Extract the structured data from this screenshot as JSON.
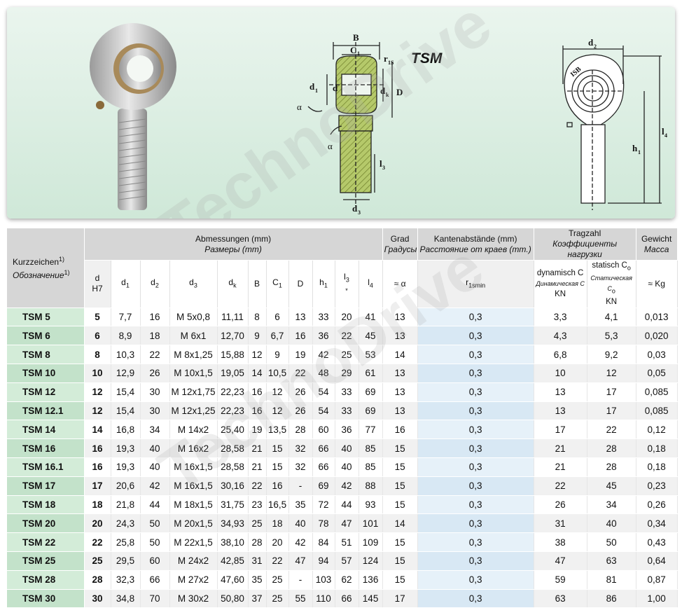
{
  "diagram": {
    "model": "TSM",
    "labels": {
      "B": "B",
      "C1": "C",
      "C1_sub": "1",
      "r1s": "r",
      "r1s_sub": "1S",
      "d1": "d",
      "d1_sub": "1",
      "d": "d",
      "dk": "d",
      "dk_sub": "k",
      "D": "D",
      "alpha1": "α",
      "alpha2": "α",
      "l3": "l",
      "l3_sub": "3",
      "d3": "d",
      "d3_sub": "3",
      "d2": "d",
      "d2_sub": "2",
      "isb": "ISB",
      "h1": "h",
      "h1_sub": "1",
      "l4": "l",
      "l4_sub": "4"
    }
  },
  "watermark": "TechnoDrive",
  "table": {
    "headers": {
      "kurz": "Kurzzeichen",
      "kurz_sup": "1)",
      "obozn": "Обозначение",
      "obozn_sup": "1)",
      "abm": "Abmessungen (mm)",
      "razm": "Размеры (mm)",
      "grad": "Grad",
      "gradusy": "Градусы",
      "kanten": "Kantenabstände (mm)",
      "rasst": "Расстояние от краев (mm.)",
      "tragzahl": "Tragzahl",
      "koef": "Коэффициенты нагрузки",
      "gewicht": "Gewicht",
      "massa": "Масса"
    },
    "subheaders": {
      "d": "d",
      "h7": "H7",
      "d1": "d",
      "d1s": "1",
      "d2": "d",
      "d2s": "2",
      "d3": "d",
      "d3s": "3",
      "dk": "d",
      "dks": "k",
      "B": "B",
      "C1": "C",
      "C1s": "1",
      "D": "D",
      "h1": "h",
      "h1s": "1",
      "l3": "l",
      "l3s": "3",
      "star": "*",
      "l4": "l",
      "l4s": "4",
      "alpha": "≈ α",
      "r1": "r",
      "r1s": "1smin",
      "dyn": "dynamisch C",
      "dyn_ru": "Динамическая C",
      "kn1": "KN",
      "stat": "statisch C",
      "stat_s": "o",
      "stat_ru": "Статическая C",
      "stat_ru_s": "o",
      "kn2": "KN",
      "kg": "≈ Kg"
    },
    "rows": [
      [
        "TSM 5",
        "5",
        "7,7",
        "16",
        "M 5x0,8",
        "11,11",
        "8",
        "6",
        "13",
        "33",
        "20",
        "41",
        "13",
        "0,3",
        "3,3",
        "4,1",
        "0,013"
      ],
      [
        "TSM 6",
        "6",
        "8,9",
        "18",
        "M 6x1",
        "12,70",
        "9",
        "6,7",
        "16",
        "36",
        "22",
        "45",
        "13",
        "0,3",
        "4,3",
        "5,3",
        "0,020"
      ],
      [
        "TSM 8",
        "8",
        "10,3",
        "22",
        "M 8x1,25",
        "15,88",
        "12",
        "9",
        "19",
        "42",
        "25",
        "53",
        "14",
        "0,3",
        "6,8",
        "9,2",
        "0,03"
      ],
      [
        "TSM 10",
        "10",
        "12,9",
        "26",
        "M 10x1,5",
        "19,05",
        "14",
        "10,5",
        "22",
        "48",
        "29",
        "61",
        "13",
        "0,3",
        "10",
        "12",
        "0,05"
      ],
      [
        "TSM 12",
        "12",
        "15,4",
        "30",
        "M 12x1,75",
        "22,23",
        "16",
        "12",
        "26",
        "54",
        "33",
        "69",
        "13",
        "0,3",
        "13",
        "17",
        "0,085"
      ],
      [
        "TSM 12.1",
        "12",
        "15,4",
        "30",
        "M 12x1,25",
        "22,23",
        "16",
        "12",
        "26",
        "54",
        "33",
        "69",
        "13",
        "0,3",
        "13",
        "17",
        "0,085"
      ],
      [
        "TSM 14",
        "14",
        "16,8",
        "34",
        "M 14x2",
        "25,40",
        "19",
        "13,5",
        "28",
        "60",
        "36",
        "77",
        "16",
        "0,3",
        "17",
        "22",
        "0,12"
      ],
      [
        "TSM 16",
        "16",
        "19,3",
        "40",
        "M 16x2",
        "28,58",
        "21",
        "15",
        "32",
        "66",
        "40",
        "85",
        "15",
        "0,3",
        "21",
        "28",
        "0,18"
      ],
      [
        "TSM 16.1",
        "16",
        "19,3",
        "40",
        "M 16x1,5",
        "28,58",
        "21",
        "15",
        "32",
        "66",
        "40",
        "85",
        "15",
        "0,3",
        "21",
        "28",
        "0,18"
      ],
      [
        "TSM 17",
        "17",
        "20,6",
        "42",
        "M 16x1,5",
        "30,16",
        "22",
        "16",
        "-",
        "69",
        "42",
        "88",
        "15",
        "0,3",
        "22",
        "45",
        "0,23"
      ],
      [
        "TSM 18",
        "18",
        "21,8",
        "44",
        "M 18x1,5",
        "31,75",
        "23",
        "16,5",
        "35",
        "72",
        "44",
        "93",
        "15",
        "0,3",
        "26",
        "34",
        "0,26"
      ],
      [
        "TSM 20",
        "20",
        "24,3",
        "50",
        "M 20x1,5",
        "34,93",
        "25",
        "18",
        "40",
        "78",
        "47",
        "101",
        "14",
        "0,3",
        "31",
        "40",
        "0,34"
      ],
      [
        "TSM 22",
        "22",
        "25,8",
        "50",
        "M 22x1,5",
        "38,10",
        "28",
        "20",
        "42",
        "84",
        "51",
        "109",
        "15",
        "0,3",
        "38",
        "50",
        "0,43"
      ],
      [
        "TSM 25",
        "25",
        "29,5",
        "60",
        "M 24x2",
        "42,85",
        "31",
        "22",
        "47",
        "94",
        "57",
        "124",
        "15",
        "0,3",
        "47",
        "63",
        "0,64"
      ],
      [
        "TSM 28",
        "28",
        "32,3",
        "66",
        "M 27x2",
        "47,60",
        "35",
        "25",
        "-",
        "103",
        "62",
        "136",
        "15",
        "0,3",
        "59",
        "81",
        "0,87"
      ],
      [
        "TSM 30",
        "30",
        "34,8",
        "70",
        "M 30x2",
        "50,80",
        "37",
        "25",
        "55",
        "110",
        "66",
        "145",
        "17",
        "0,3",
        "63",
        "86",
        "1,00"
      ]
    ]
  }
}
